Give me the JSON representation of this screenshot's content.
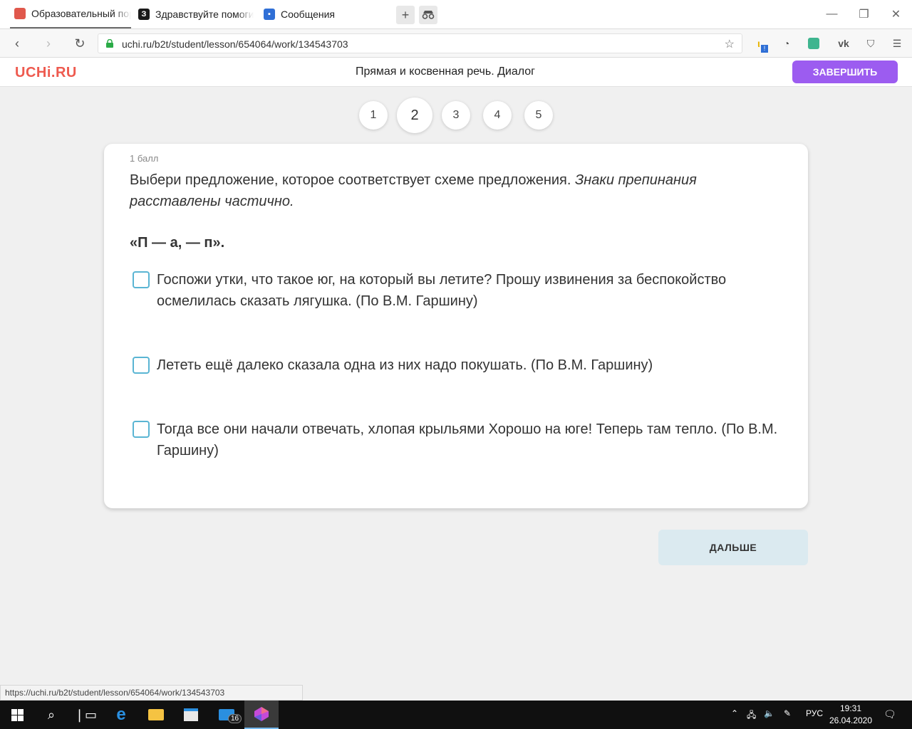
{
  "browser": {
    "tabs": [
      {
        "title": "Образовательный пор",
        "favicon": "uchi-favicon",
        "color": "#e0584c",
        "active": true
      },
      {
        "title": "Здравствуйте помогит",
        "favicon": "znanija-favicon",
        "color": "#1a1a1a",
        "active": false
      },
      {
        "title": "Сообщения",
        "favicon": "chat-favicon",
        "color": "#2f6fd6",
        "active": false
      }
    ],
    "url": "uchi.ru/b2t/student/lesson/654064/work/134543703",
    "status_url": "https://uchi.ru/b2t/student/lesson/654064/work/134543703",
    "extension_badge": "!"
  },
  "header": {
    "logo": "UCHi.RU",
    "lesson_title": "Прямая и косвенная речь. Диалог",
    "finish_label": "ЗАВЕРШИТЬ"
  },
  "steps": [
    {
      "label": "1",
      "current": false
    },
    {
      "label": "2",
      "current": true
    },
    {
      "label": "3",
      "current": false
    },
    {
      "label": "4",
      "current": false
    },
    {
      "label": "5",
      "current": false
    }
  ],
  "task": {
    "points": "1 балл",
    "question_main": "Выбери предложение, которое соответствует схеме предложения. ",
    "question_note": "Знаки препинания расставлены частично.",
    "scheme": "«П — а, — п».",
    "options": [
      {
        "text": "Госпожи утки, что такое юг, на который вы летите? Прошу извинения за беспокойство осмелилась сказать лягушка. (По В.М. Гаршину)",
        "checked": false
      },
      {
        "text": "Лететь ещё далеко сказала одна из них надо покушать. (По В.М. Гаршину)",
        "checked": false
      },
      {
        "text": "Тогда все они начали отвечать, хлопая крыльями Хорошо на юге! Теперь там тепло. (По В.М. Гаршину)",
        "checked": false
      }
    ],
    "next_label": "ДАЛЬШЕ"
  },
  "taskbar": {
    "mail_badge": "16",
    "language": "РУС",
    "time": "19:31",
    "date": "26.04.2020"
  },
  "colors": {
    "accent": "#9c5cf0",
    "logo": "#ee5a4f",
    "checkbox_border": "#5ab5d3",
    "next_button": "#dbeaf0"
  }
}
